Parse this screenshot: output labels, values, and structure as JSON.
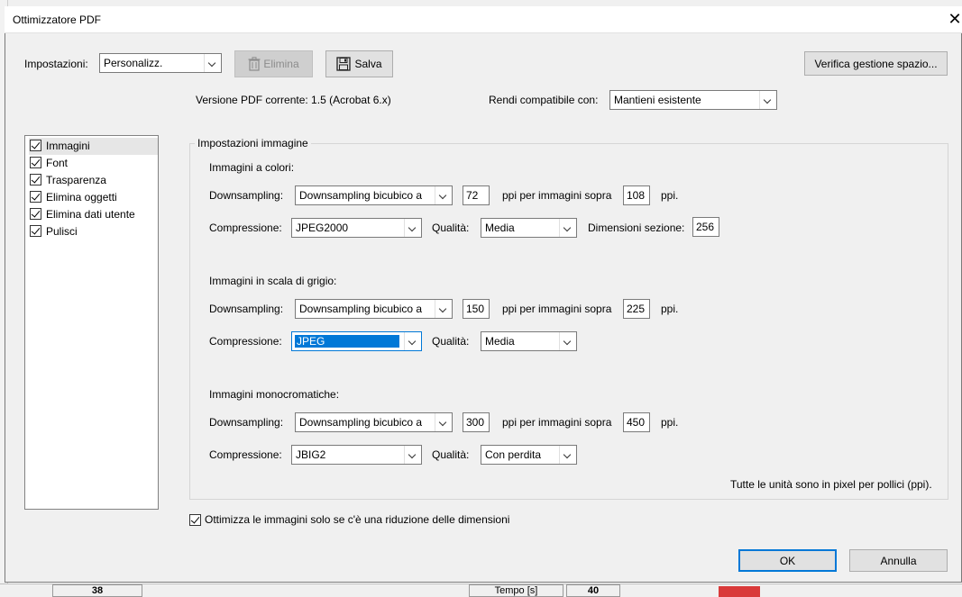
{
  "window": {
    "title": "Ottimizzatore PDF"
  },
  "toolbar": {
    "settings_label": "Impostazioni:",
    "settings_value": "Personalizz.",
    "delete_label": "Elimina",
    "save_label": "Salva",
    "verify_label": "Verifica gestione spazio..."
  },
  "pdf_info": {
    "current_version": "Versione PDF corrente: 1.5 (Acrobat 6.x)",
    "compat_label": "Rendi compatibile con:",
    "compat_value": "Mantieni esistente"
  },
  "sidebar": {
    "items": [
      {
        "label": "Immagini",
        "checked": true
      },
      {
        "label": "Font",
        "checked": true
      },
      {
        "label": "Trasparenza",
        "checked": true
      },
      {
        "label": "Elimina oggetti",
        "checked": true
      },
      {
        "label": "Elimina dati utente",
        "checked": true
      },
      {
        "label": "Pulisci",
        "checked": true
      }
    ]
  },
  "image_settings": {
    "group_title": "Impostazioni immagine",
    "color": {
      "heading": "Immagini a colori:",
      "downsampling_label": "Downsampling:",
      "downsampling_value": "Downsampling bicubico a",
      "ppi_value": "72",
      "ppi_above_label": "ppi per immagini sopra",
      "above_value": "108",
      "ppi_unit": "ppi.",
      "compression_label": "Compressione:",
      "compression_value": "JPEG2000",
      "quality_label": "Qualità:",
      "quality_value": "Media",
      "tile_label": "Dimensioni sezione:",
      "tile_value": "256"
    },
    "gray": {
      "heading": "Immagini in scala di grigio:",
      "downsampling_label": "Downsampling:",
      "downsampling_value": "Downsampling bicubico a",
      "ppi_value": "150",
      "ppi_above_label": "ppi per immagini sopra",
      "above_value": "225",
      "ppi_unit": "ppi.",
      "compression_label": "Compressione:",
      "compression_value": "JPEG",
      "quality_label": "Qualità:",
      "quality_value": "Media"
    },
    "mono": {
      "heading": "Immagini monocromatiche:",
      "downsampling_label": "Downsampling:",
      "downsampling_value": "Downsampling bicubico a",
      "ppi_value": "300",
      "ppi_above_label": "ppi per immagini sopra",
      "above_value": "450",
      "ppi_unit": "ppi.",
      "compression_label": "Compressione:",
      "compression_value": "JBIG2",
      "quality_label": "Qualità:",
      "quality_value": "Con perdita"
    },
    "units_note": "Tutte le unità sono in pixel per pollici (ppi)."
  },
  "optimize_option": {
    "label": "Ottimizza le immagini solo se c'è una riduzione delle dimensioni",
    "checked": true
  },
  "footer": {
    "ok_label": "OK",
    "cancel_label": "Annulla"
  },
  "colors": {
    "accent": "#0078d7",
    "dialog_bg": "#f0f0f0"
  },
  "background": {
    "cell_left": "38",
    "cell_mid": "Tempo [s]",
    "cell_right": "40"
  }
}
